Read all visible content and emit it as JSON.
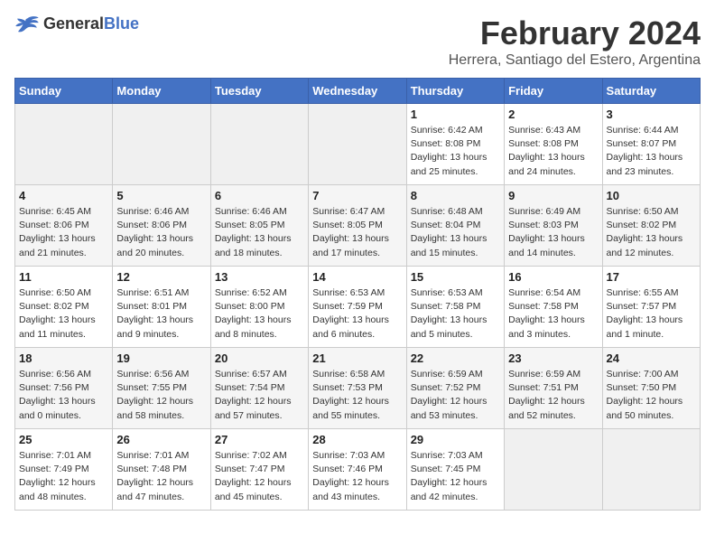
{
  "header": {
    "logo_general": "General",
    "logo_blue": "Blue",
    "month_year": "February 2024",
    "location": "Herrera, Santiago del Estero, Argentina"
  },
  "calendar": {
    "days_of_week": [
      "Sunday",
      "Monday",
      "Tuesday",
      "Wednesday",
      "Thursday",
      "Friday",
      "Saturday"
    ],
    "weeks": [
      [
        {
          "day": "",
          "info": ""
        },
        {
          "day": "",
          "info": ""
        },
        {
          "day": "",
          "info": ""
        },
        {
          "day": "",
          "info": ""
        },
        {
          "day": "1",
          "info": "Sunrise: 6:42 AM\nSunset: 8:08 PM\nDaylight: 13 hours and 25 minutes."
        },
        {
          "day": "2",
          "info": "Sunrise: 6:43 AM\nSunset: 8:08 PM\nDaylight: 13 hours and 24 minutes."
        },
        {
          "day": "3",
          "info": "Sunrise: 6:44 AM\nSunset: 8:07 PM\nDaylight: 13 hours and 23 minutes."
        }
      ],
      [
        {
          "day": "4",
          "info": "Sunrise: 6:45 AM\nSunset: 8:06 PM\nDaylight: 13 hours and 21 minutes."
        },
        {
          "day": "5",
          "info": "Sunrise: 6:46 AM\nSunset: 8:06 PM\nDaylight: 13 hours and 20 minutes."
        },
        {
          "day": "6",
          "info": "Sunrise: 6:46 AM\nSunset: 8:05 PM\nDaylight: 13 hours and 18 minutes."
        },
        {
          "day": "7",
          "info": "Sunrise: 6:47 AM\nSunset: 8:05 PM\nDaylight: 13 hours and 17 minutes."
        },
        {
          "day": "8",
          "info": "Sunrise: 6:48 AM\nSunset: 8:04 PM\nDaylight: 13 hours and 15 minutes."
        },
        {
          "day": "9",
          "info": "Sunrise: 6:49 AM\nSunset: 8:03 PM\nDaylight: 13 hours and 14 minutes."
        },
        {
          "day": "10",
          "info": "Sunrise: 6:50 AM\nSunset: 8:02 PM\nDaylight: 13 hours and 12 minutes."
        }
      ],
      [
        {
          "day": "11",
          "info": "Sunrise: 6:50 AM\nSunset: 8:02 PM\nDaylight: 13 hours and 11 minutes."
        },
        {
          "day": "12",
          "info": "Sunrise: 6:51 AM\nSunset: 8:01 PM\nDaylight: 13 hours and 9 minutes."
        },
        {
          "day": "13",
          "info": "Sunrise: 6:52 AM\nSunset: 8:00 PM\nDaylight: 13 hours and 8 minutes."
        },
        {
          "day": "14",
          "info": "Sunrise: 6:53 AM\nSunset: 7:59 PM\nDaylight: 13 hours and 6 minutes."
        },
        {
          "day": "15",
          "info": "Sunrise: 6:53 AM\nSunset: 7:58 PM\nDaylight: 13 hours and 5 minutes."
        },
        {
          "day": "16",
          "info": "Sunrise: 6:54 AM\nSunset: 7:58 PM\nDaylight: 13 hours and 3 minutes."
        },
        {
          "day": "17",
          "info": "Sunrise: 6:55 AM\nSunset: 7:57 PM\nDaylight: 13 hours and 1 minute."
        }
      ],
      [
        {
          "day": "18",
          "info": "Sunrise: 6:56 AM\nSunset: 7:56 PM\nDaylight: 13 hours and 0 minutes."
        },
        {
          "day": "19",
          "info": "Sunrise: 6:56 AM\nSunset: 7:55 PM\nDaylight: 12 hours and 58 minutes."
        },
        {
          "day": "20",
          "info": "Sunrise: 6:57 AM\nSunset: 7:54 PM\nDaylight: 12 hours and 57 minutes."
        },
        {
          "day": "21",
          "info": "Sunrise: 6:58 AM\nSunset: 7:53 PM\nDaylight: 12 hours and 55 minutes."
        },
        {
          "day": "22",
          "info": "Sunrise: 6:59 AM\nSunset: 7:52 PM\nDaylight: 12 hours and 53 minutes."
        },
        {
          "day": "23",
          "info": "Sunrise: 6:59 AM\nSunset: 7:51 PM\nDaylight: 12 hours and 52 minutes."
        },
        {
          "day": "24",
          "info": "Sunrise: 7:00 AM\nSunset: 7:50 PM\nDaylight: 12 hours and 50 minutes."
        }
      ],
      [
        {
          "day": "25",
          "info": "Sunrise: 7:01 AM\nSunset: 7:49 PM\nDaylight: 12 hours and 48 minutes."
        },
        {
          "day": "26",
          "info": "Sunrise: 7:01 AM\nSunset: 7:48 PM\nDaylight: 12 hours and 47 minutes."
        },
        {
          "day": "27",
          "info": "Sunrise: 7:02 AM\nSunset: 7:47 PM\nDaylight: 12 hours and 45 minutes."
        },
        {
          "day": "28",
          "info": "Sunrise: 7:03 AM\nSunset: 7:46 PM\nDaylight: 12 hours and 43 minutes."
        },
        {
          "day": "29",
          "info": "Sunrise: 7:03 AM\nSunset: 7:45 PM\nDaylight: 12 hours and 42 minutes."
        },
        {
          "day": "",
          "info": ""
        },
        {
          "day": "",
          "info": ""
        }
      ]
    ]
  }
}
